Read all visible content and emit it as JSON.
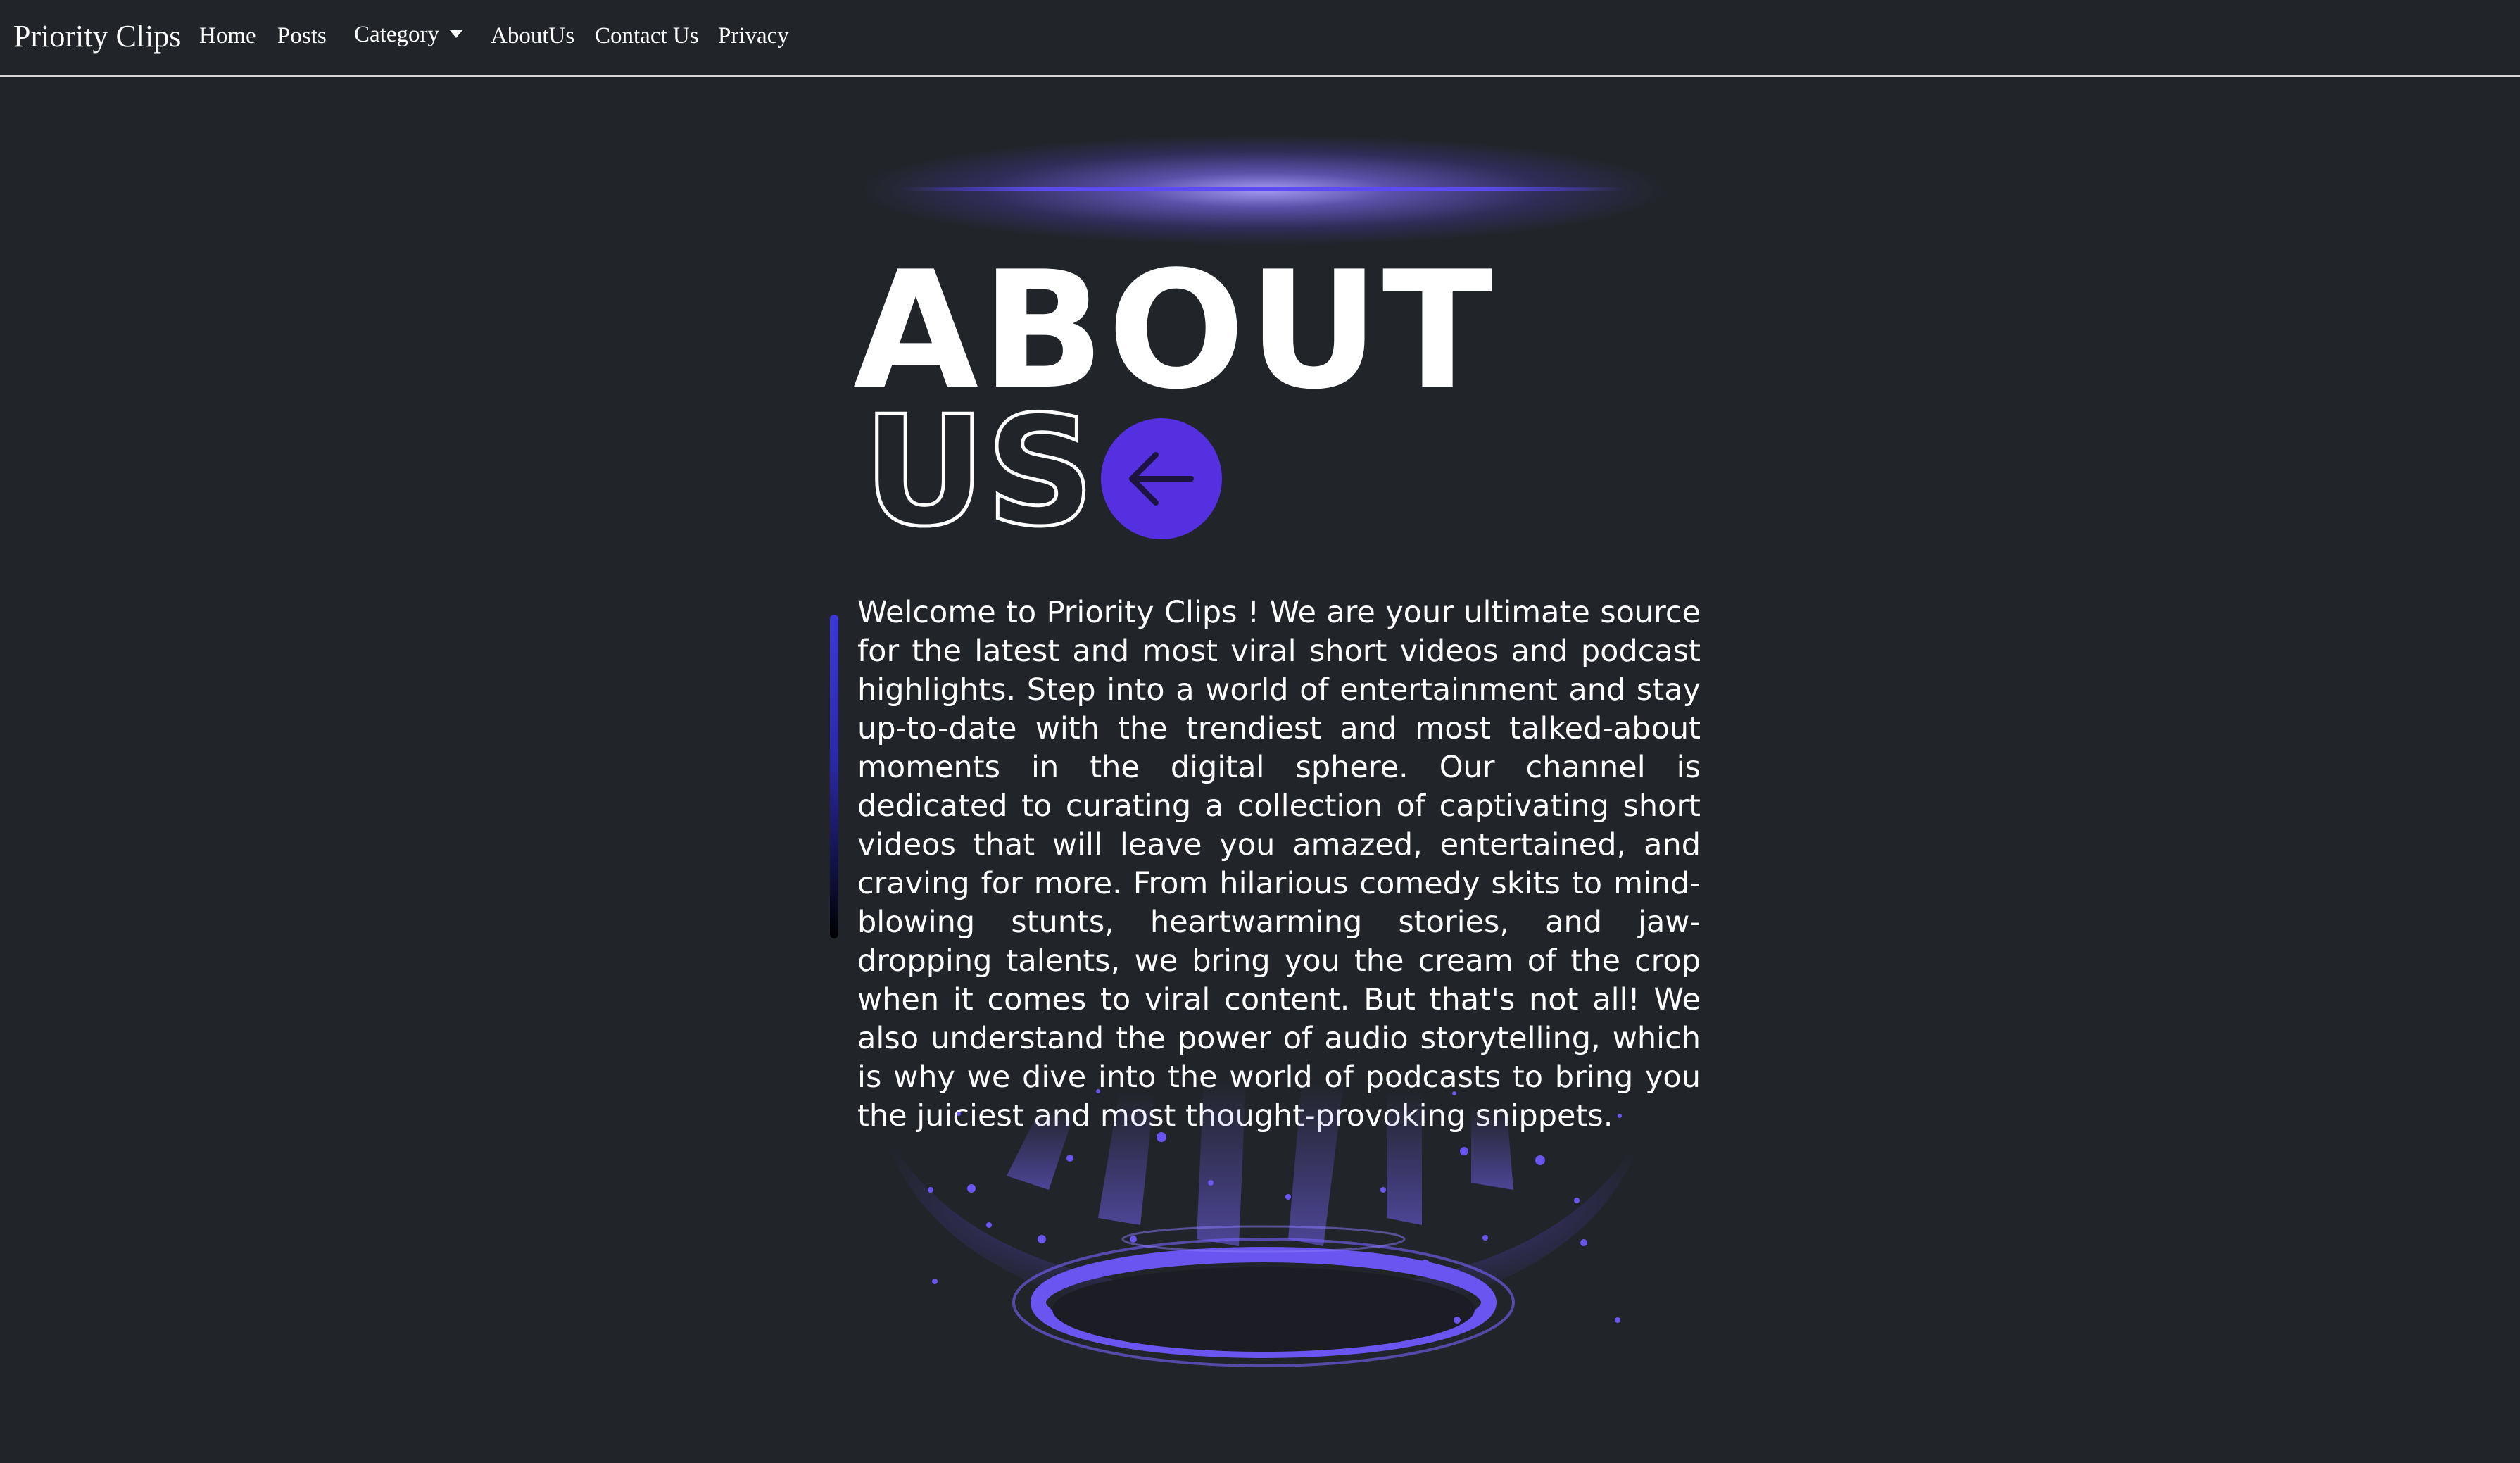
{
  "navbar": {
    "brand": "Priority Clips",
    "links": {
      "home": "Home",
      "posts": "Posts",
      "category": "Category",
      "about": "AboutUs",
      "contact": "Contact Us",
      "privacy": "Privacy"
    }
  },
  "hero": {
    "title_line1": "ABOUT",
    "title_line2": "US",
    "back_icon": "arrow-left-icon"
  },
  "content": {
    "paragraph": "Welcome to Priority Clips ! We are your ultimate source for the latest and most viral short videos and podcast highlights. Step into a world of entertainment and stay up-to-date with the trendiest and most talked-about moments in the digital sphere. Our channel is dedicated to curating a collection of captivating short videos that will leave you amazed, entertained, and craving for more. From hilarious comedy skits to mind-blowing stunts, heartwarming stories, and jaw-dropping talents, we bring you the cream of the crop when it comes to viral content. But that's not all! We also understand the power of audio storytelling, which is why we dive into the world of podcasts to bring you the juiciest and most thought-provoking snippets."
  },
  "colors": {
    "background": "#212428",
    "accent": "#5530e0",
    "glow": "#8a7dff",
    "text": "#ffffff"
  }
}
